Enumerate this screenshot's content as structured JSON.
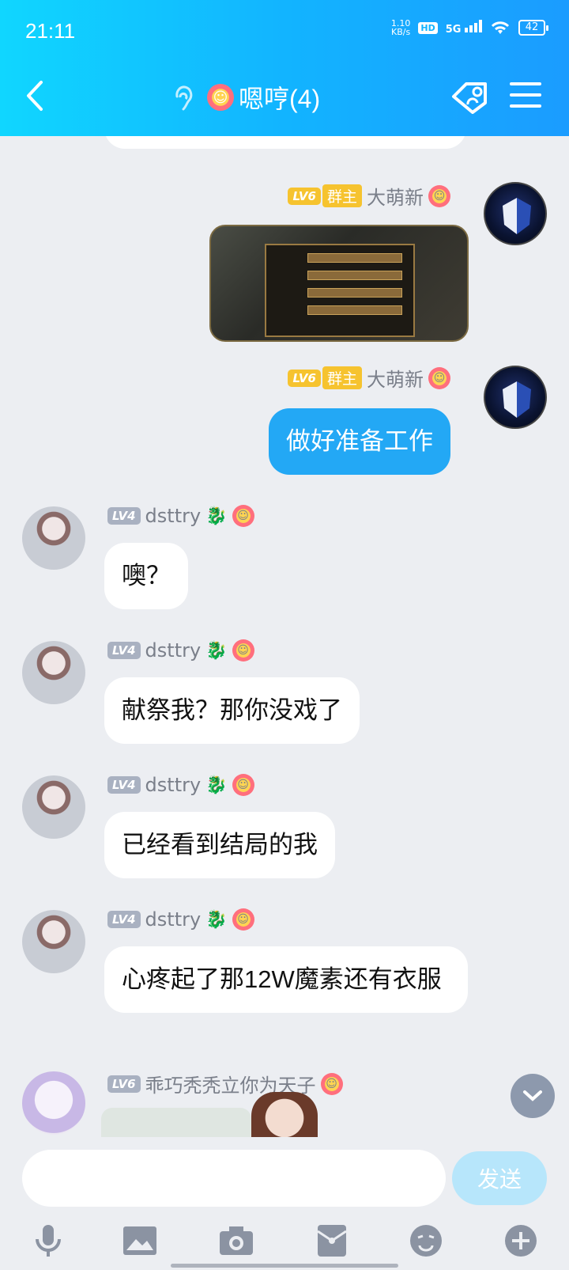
{
  "status": {
    "time": "21:11",
    "net_speed_value": "1.10",
    "net_speed_unit": "KB/s",
    "hd_badge": "HD",
    "network": "5G",
    "battery": "42"
  },
  "header": {
    "title": "嗯哼(4)"
  },
  "messages": [
    {
      "sender": "大萌新",
      "level": "LV6",
      "role": "群主",
      "type": "image"
    },
    {
      "sender": "大萌新",
      "level": "LV6",
      "role": "群主",
      "text": "做好准备工作"
    },
    {
      "sender": "dsttry",
      "level": "LV4",
      "text": "噢？"
    },
    {
      "sender": "dsttry",
      "level": "LV4",
      "text": "献祭我？那你没戏了"
    },
    {
      "sender": "dsttry",
      "level": "LV4",
      "text": "已经看到结局的我"
    },
    {
      "sender": "dsttry",
      "level": "LV4",
      "text": "心疼起了那12W魔素还有衣服"
    },
    {
      "sender": "乖巧秃秃立你为天子",
      "level": "LV6"
    }
  ],
  "input": {
    "placeholder": "",
    "send_label": "发送"
  },
  "toolbar": [
    "mic-icon",
    "image-icon",
    "camera-icon",
    "red-packet-icon",
    "emoji-icon",
    "plus-icon"
  ],
  "colors": {
    "header_start": "#10d6ff",
    "header_end": "#1b9cff",
    "my_bubble": "#23a8f5",
    "send_disabled": "#b7e6fb"
  }
}
